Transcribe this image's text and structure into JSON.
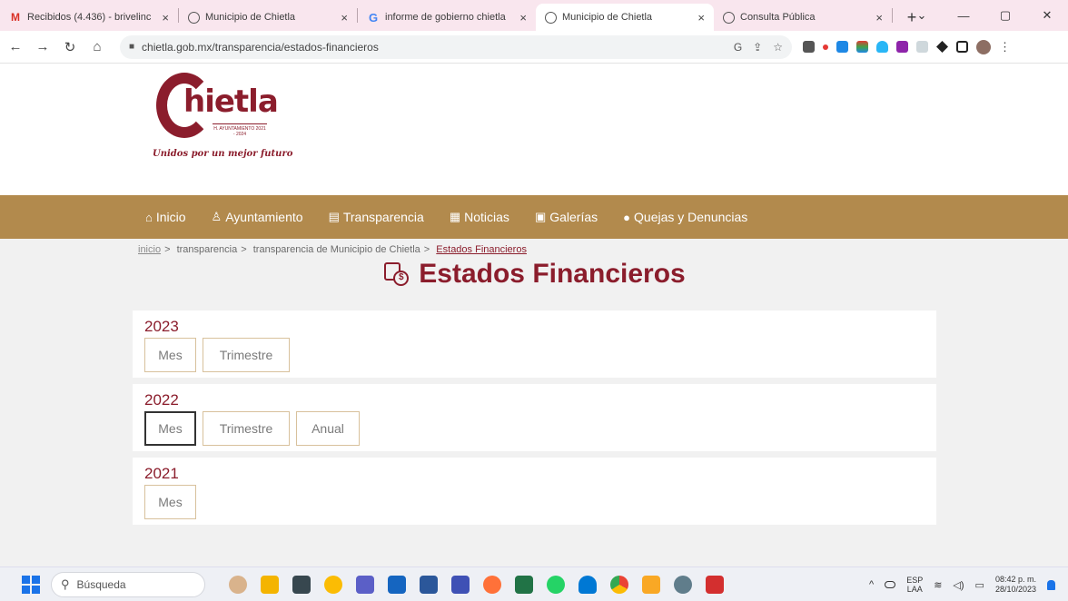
{
  "browser": {
    "tabs": [
      {
        "label": "Recibidos (4.436) - brivelinc",
        "favicon": "gmail-icon",
        "active": false
      },
      {
        "label": "Municipio de Chietla",
        "favicon": "globe-icon",
        "active": false
      },
      {
        "label": "informe de gobierno chietla",
        "favicon": "google-icon",
        "active": false
      },
      {
        "label": "Municipio de Chietla",
        "favicon": "globe-icon",
        "active": true
      },
      {
        "label": "Consulta Pública",
        "favicon": "globe-icon",
        "active": false
      }
    ],
    "close_glyph": "×",
    "new_tab_glyph": "+",
    "window_controls": {
      "dropdown": "⌄",
      "minimize": "—",
      "maximize": "▢",
      "close": "✕"
    },
    "nav": {
      "back": "←",
      "forward": "→",
      "reload": "↻",
      "home": "⌂"
    },
    "url": "chietla.gob.mx/transparencia/estados-financieros",
    "omnibox_icons": {
      "google_lens": "G",
      "share": "⇪",
      "bookmark": "☆"
    }
  },
  "logo": {
    "brand": "hietla",
    "ayuntamiento": "H. AYUNTAMIENTO 2021 - 2024",
    "tagline": "Unidos por un mejor futuro",
    "color": "#8b1d2c"
  },
  "nav": {
    "items": [
      {
        "label": "Inicio",
        "icon": "⌂",
        "icon_name": "home-icon"
      },
      {
        "label": "Ayuntamiento",
        "icon": "♙",
        "icon_name": "org-chart-icon"
      },
      {
        "label": "Transparencia",
        "icon": "▤",
        "icon_name": "document-icon"
      },
      {
        "label": "Noticias",
        "icon": "▦",
        "icon_name": "newspaper-icon"
      },
      {
        "label": "Galerías",
        "icon": "▣",
        "icon_name": "gallery-icon"
      },
      {
        "label": "Quejas y Denuncias",
        "icon": "●",
        "icon_name": "info-icon"
      }
    ],
    "bar_color": "#b28a4d"
  },
  "breadcrumb": {
    "items": [
      "inicio",
      "transparencia",
      "transparencia de Municipio de Chietla",
      "Estados Financieros"
    ],
    "separator": ">"
  },
  "page": {
    "title": "Estados Financieros",
    "coin_glyph": "$"
  },
  "years": [
    {
      "year": "2023",
      "buttons": [
        "Mes",
        "Trimestre"
      ]
    },
    {
      "year": "2022",
      "buttons": [
        "Mes",
        "Trimestre",
        "Anual"
      ]
    },
    {
      "year": "2021",
      "buttons": [
        "Mes"
      ]
    }
  ],
  "taskbar": {
    "search_placeholder": "Búsqueda",
    "search_glyph": "⚲",
    "lang_top": "ESP",
    "lang_bottom": "LAA",
    "time": "08:42 p. m.",
    "date": "28/10/2023",
    "tray_chevron": "^",
    "tray_icons": {
      "wifi": "≋",
      "volume": "◁)",
      "battery": "▭"
    }
  }
}
